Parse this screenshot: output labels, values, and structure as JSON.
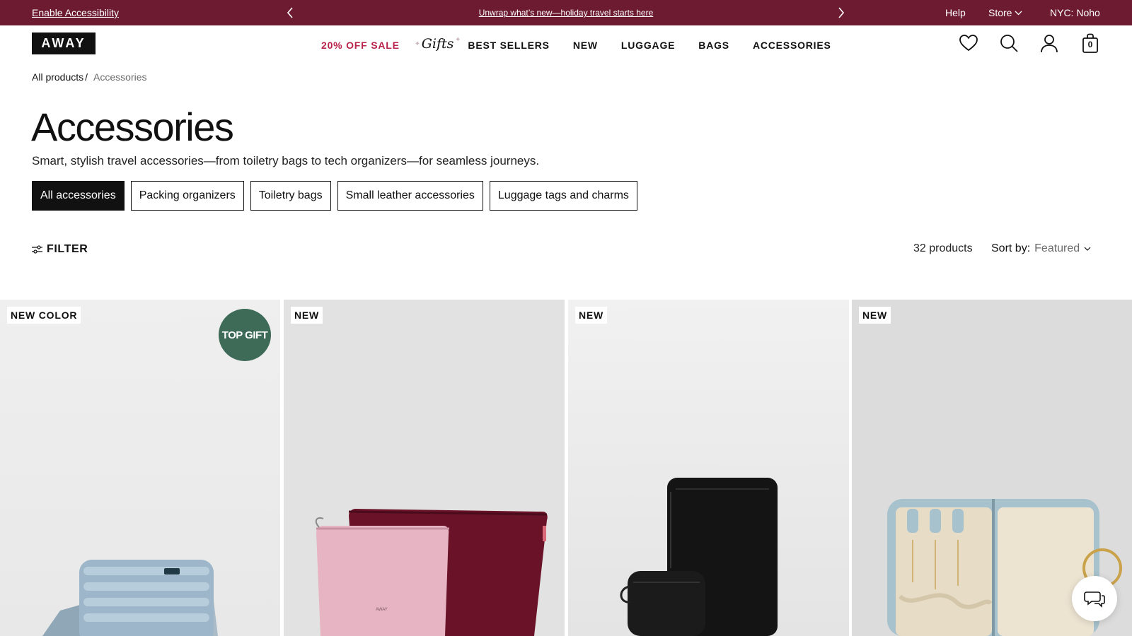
{
  "announcement": {
    "accessibility_link": "Enable Accessibility",
    "promo_text": "Unwrap what’s new—holiday travel starts here",
    "prev_icon": "chevron-left-icon",
    "next_icon": "chevron-right-icon",
    "help": "Help",
    "store": "Store",
    "location": "NYC: Noho",
    "bar_color": "#6d1b31"
  },
  "header": {
    "logo": "AWAY",
    "nav": {
      "sale": "20% OFF SALE",
      "gifts": "Gifts",
      "best_sellers": "BEST SELLERS",
      "new": "NEW",
      "luggage": "LUGGAGE",
      "bags": "BAGS",
      "accessories": "ACCESSORIES"
    },
    "sale_color": "#b8234b",
    "icons": [
      "heart-icon",
      "search-icon",
      "user-icon",
      "bag-icon"
    ],
    "cart_count": "0"
  },
  "breadcrumb": {
    "root": "All products",
    "separator": "/",
    "current": "Accessories"
  },
  "page": {
    "title": "Accessories",
    "description": "Smart, stylish travel accessories—from toiletry bags to tech organizers—for seamless journeys."
  },
  "categories": {
    "all": "All accessories",
    "packing": "Packing organizers",
    "toiletry": "Toiletry bags",
    "leather": "Small leather accessories",
    "tags": "Luggage tags and charms"
  },
  "toolbar": {
    "filter": "FILTER",
    "count": "32 products",
    "sort_label": "Sort by:",
    "sort_value": "Featured"
  },
  "products": [
    {
      "badge": "NEW COLOR",
      "extra_badge": "TOP GIFT"
    },
    {
      "badge": "NEW"
    },
    {
      "badge": "NEW"
    },
    {
      "badge": "NEW"
    }
  ],
  "chat": {
    "icon": "chat-icon"
  }
}
